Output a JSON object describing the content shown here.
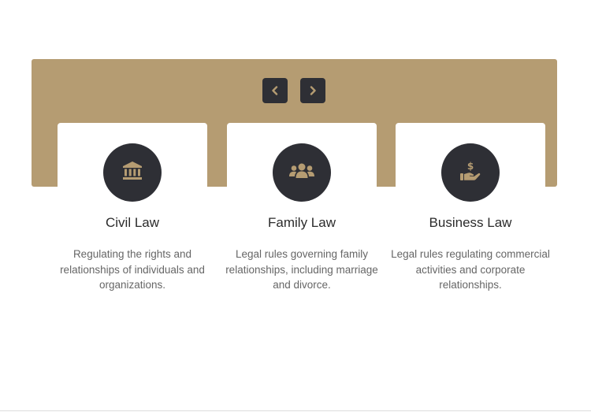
{
  "theme": {
    "accent": "#b59c72",
    "dark": "#2e2f35"
  },
  "carousel": {
    "prev_icon": "chevron-left-icon",
    "next_icon": "chevron-right-icon"
  },
  "cards": [
    {
      "icon": "bank-building-icon",
      "title": "Civil Law",
      "description": "Regulating the rights and relationships of individuals and organizations."
    },
    {
      "icon": "users-group-icon",
      "title": "Family Law",
      "description": "Legal rules governing family relationships, including marriage and divorce."
    },
    {
      "icon": "hand-holding-dollar-icon",
      "title": "Business Law",
      "description": "Legal rules regulating commercial activities and corporate relationships."
    }
  ]
}
